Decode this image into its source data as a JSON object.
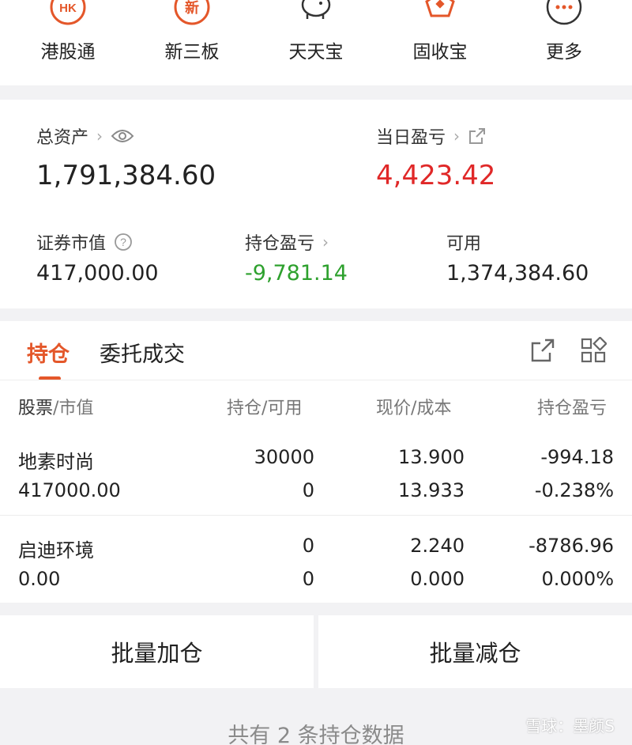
{
  "quick_nav": [
    {
      "label": "港股通",
      "icon": "hk-icon",
      "icon_text": "HK"
    },
    {
      "label": "新三板",
      "icon": "new-icon",
      "icon_text": "新"
    },
    {
      "label": "天天宝",
      "icon": "piggy-bank-icon",
      "icon_text": ""
    },
    {
      "label": "固收宝",
      "icon": "fixed-income-icon",
      "icon_text": ""
    },
    {
      "label": "更多",
      "icon": "more-icon",
      "icon_text": "···"
    }
  ],
  "assets": {
    "total_label": "总资产",
    "total_value": "1,791,384.60",
    "daily_pnl_label": "当日盈亏",
    "daily_pnl_value": "4,423.42",
    "market_value_label": "证券市值",
    "market_value": "417,000.00",
    "position_pnl_label": "持仓盈亏",
    "position_pnl_value": "-9,781.14",
    "available_label": "可用",
    "available_value": "1,374,384.60"
  },
  "tabs": {
    "holdings": "持仓",
    "orders": "委托成交"
  },
  "table": {
    "headers": {
      "stock": "股票",
      "stock_sub": "市值",
      "position": "持仓",
      "position_sub": "可用",
      "price": "现价",
      "price_sub": "成本",
      "pnl": "持仓盈亏"
    },
    "rows": [
      {
        "name": "地素时尚",
        "market_value": "417000.00",
        "position": "30000",
        "available": "0",
        "price": "13.900",
        "cost": "13.933",
        "pnl": "-994.18",
        "pnl_pct": "-0.238%"
      },
      {
        "name": "启迪环境",
        "market_value": "0.00",
        "position": "0",
        "available": "0",
        "price": "2.240",
        "cost": "0.000",
        "pnl": "-8786.96",
        "pnl_pct": "0.000%"
      }
    ]
  },
  "actions": {
    "batch_add": "批量加仓",
    "batch_reduce": "批量减仓"
  },
  "footer": "共有 2 条持仓数据",
  "watermark": "雪球：墨颜S",
  "colors": {
    "accent": "#e4572a",
    "loss": "#2ea12e",
    "gain": "#e02828"
  }
}
